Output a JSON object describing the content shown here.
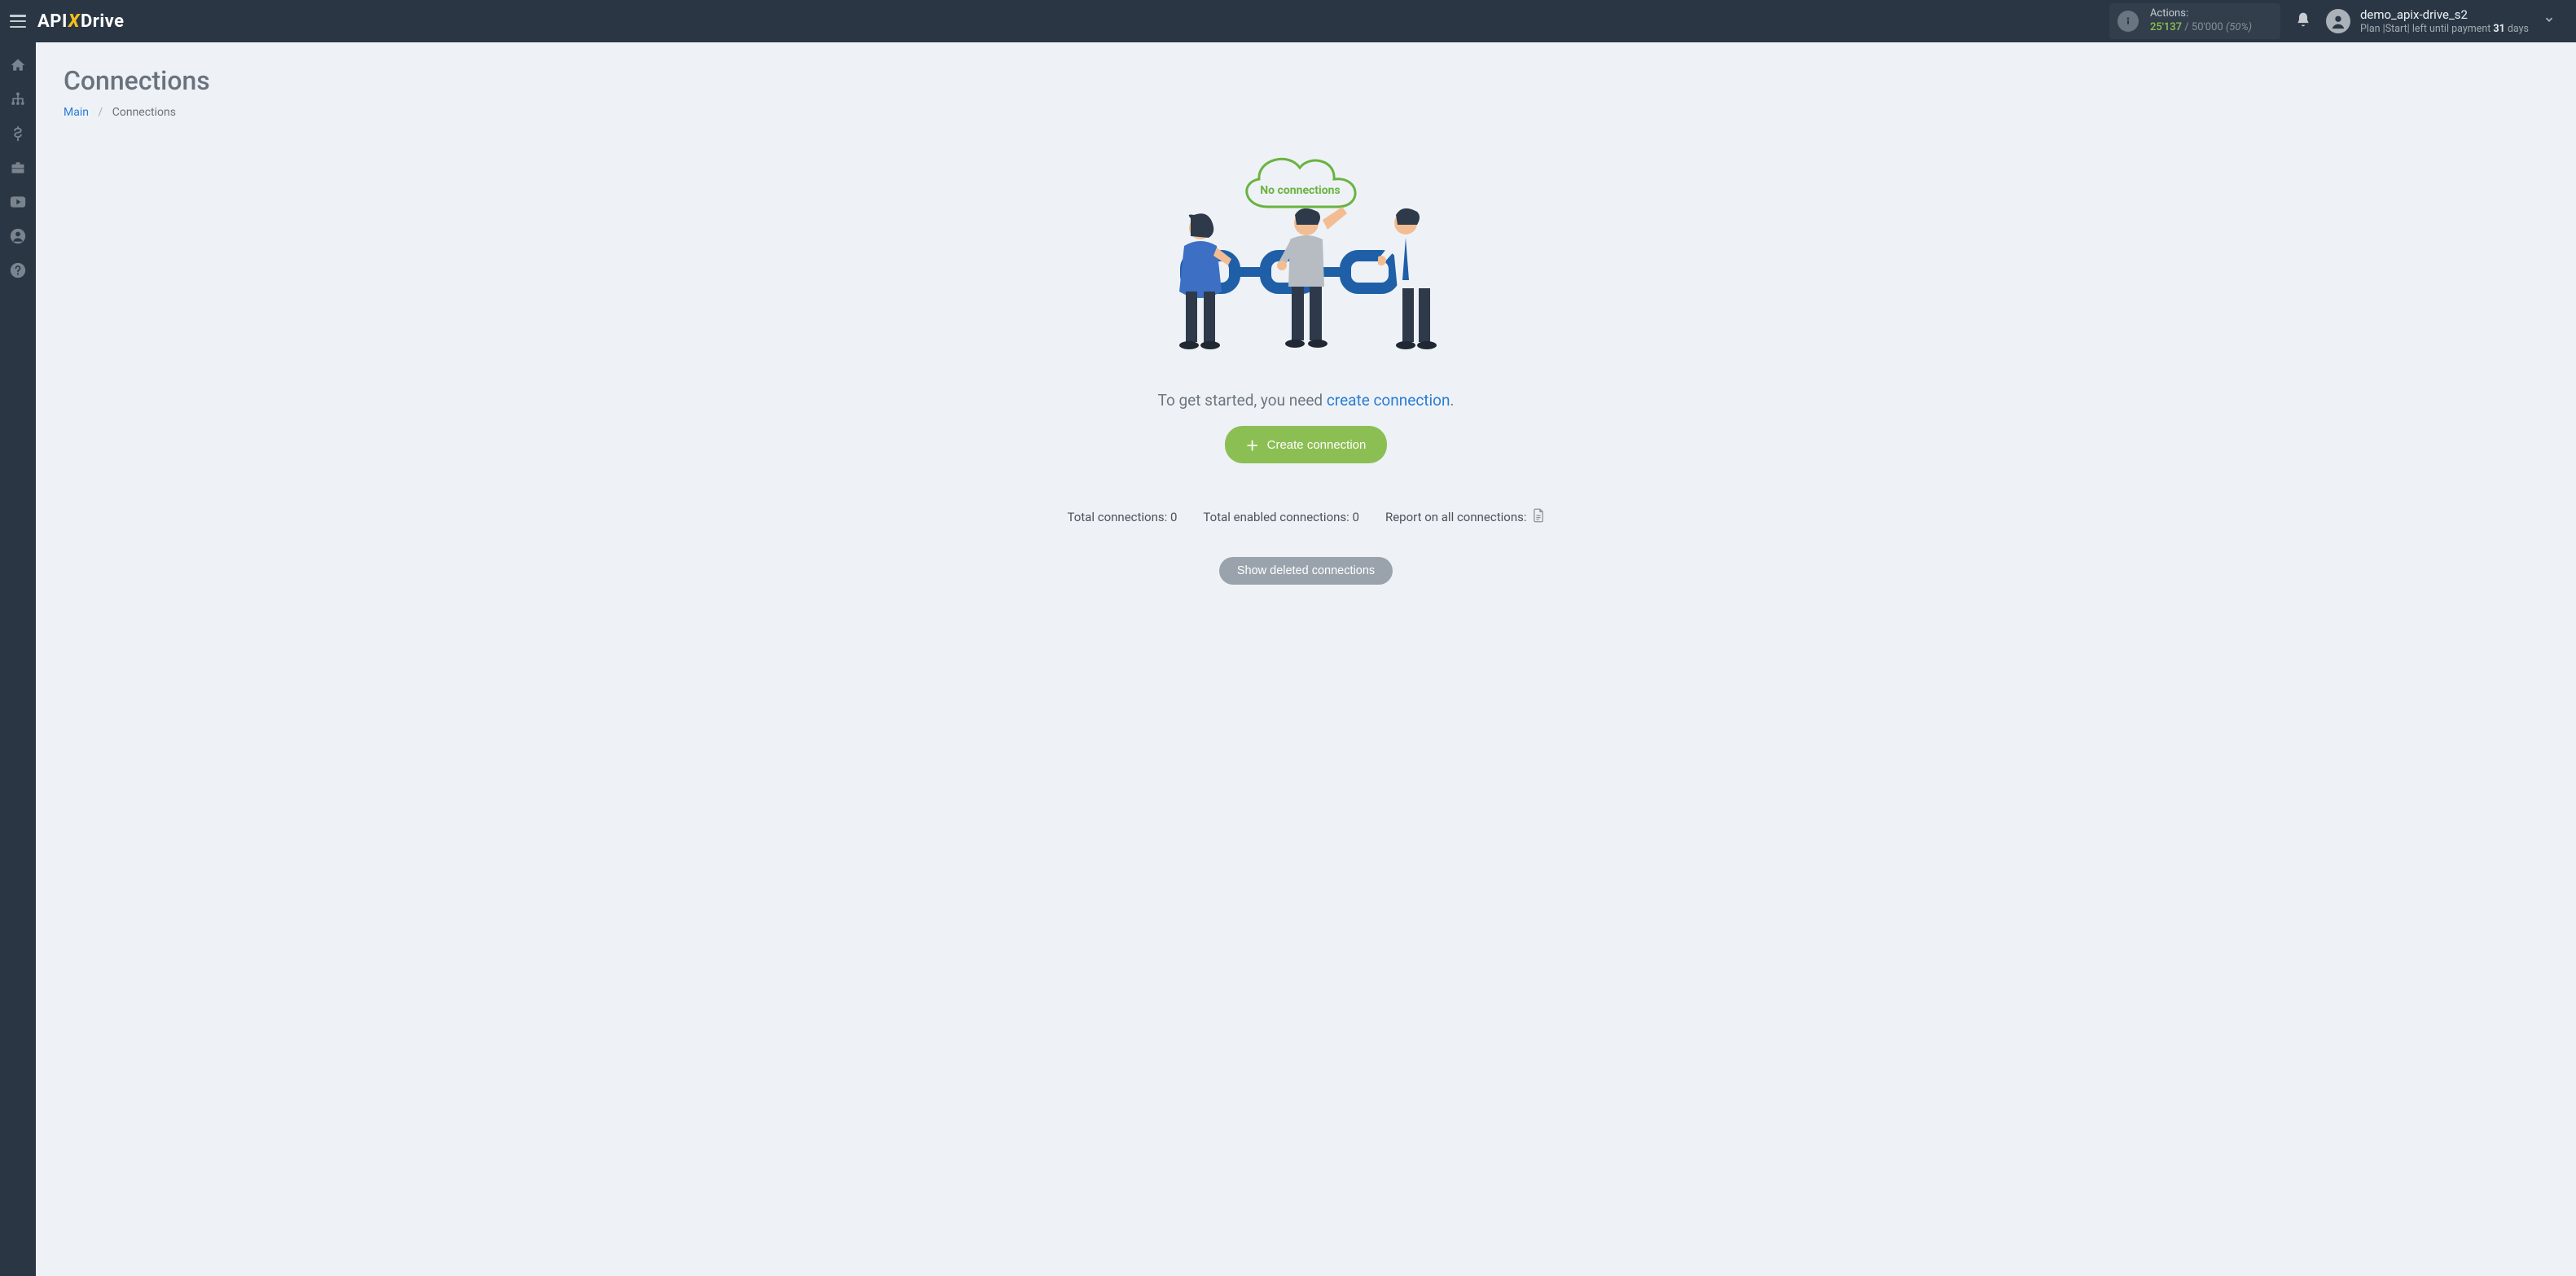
{
  "brand": {
    "part1": "API",
    "part2": "X",
    "part3": "Drive"
  },
  "actions": {
    "label": "Actions:",
    "used": "25'137",
    "separator": "/",
    "limit": "50'000",
    "percent": "(50%)"
  },
  "user": {
    "name": "demo_apix-drive_s2",
    "plan_prefix": "Plan |",
    "plan_name": "Start",
    "plan_mid": "| left until payment ",
    "days_number": "31",
    "days_word": " days"
  },
  "sidebar": {
    "items": [
      {
        "name": "home-icon"
      },
      {
        "name": "connections-icon"
      },
      {
        "name": "billing-icon"
      },
      {
        "name": "briefcase-icon"
      },
      {
        "name": "video-icon"
      },
      {
        "name": "account-icon"
      },
      {
        "name": "help-icon"
      }
    ]
  },
  "page": {
    "title": "Connections",
    "breadcrumb_main": "Main",
    "breadcrumb_current": "Connections"
  },
  "empty": {
    "cloud_text": "No connections",
    "lead_prefix": "To get started, you need ",
    "lead_link": "create connection",
    "lead_suffix": ".",
    "create_button": "Create connection"
  },
  "stats": {
    "total_label": "Total connections: ",
    "total_value": "0",
    "enabled_label": "Total enabled connections: ",
    "enabled_value": "0",
    "report_label": "Report on all connections: "
  },
  "deleted_button": "Show deleted connections"
}
